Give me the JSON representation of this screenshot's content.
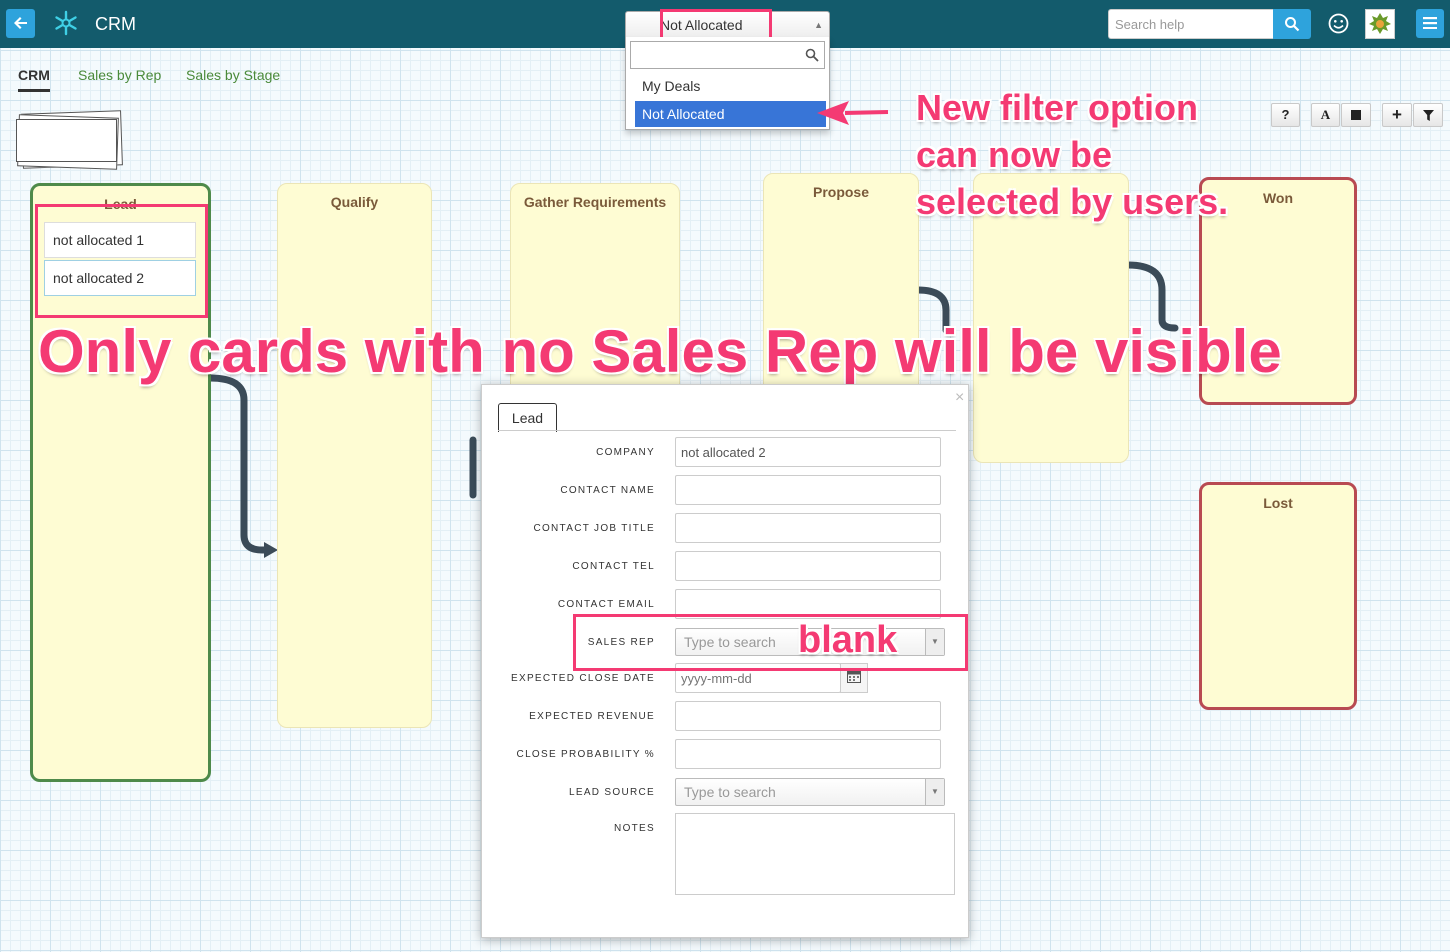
{
  "app": {
    "title": "CRM"
  },
  "header": {
    "filter_value": "Not Allocated",
    "filter_options": [
      "My Deals",
      "Not Allocated"
    ],
    "search_placeholder": "Search help"
  },
  "tabs": [
    "CRM",
    "Sales by Rep",
    "Sales by Stage"
  ],
  "toolbar": {
    "help": "?",
    "font": "A",
    "add": "+"
  },
  "board": {
    "columns": [
      {
        "title": "Lead",
        "cards": [
          "not allocated 1",
          "not allocated 2"
        ]
      },
      {
        "title": "Qualify"
      },
      {
        "title": "Gather Requirements"
      },
      {
        "title": "Propose"
      },
      {
        "title": "Won"
      },
      {
        "title": "Lost"
      }
    ]
  },
  "modal": {
    "tab": "Lead",
    "close": "×",
    "fields": [
      {
        "label": "COMPANY",
        "value": "not allocated 2"
      },
      {
        "label": "CONTACT NAME",
        "value": ""
      },
      {
        "label": "CONTACT JOB TITLE",
        "value": ""
      },
      {
        "label": "CONTACT TEL",
        "value": ""
      },
      {
        "label": "CONTACT EMAIL",
        "value": ""
      },
      {
        "label": "SALES REP",
        "placeholder": "Type to search"
      },
      {
        "label": "EXPECTED CLOSE DATE",
        "placeholder": "yyyy-mm-dd"
      },
      {
        "label": "EXPECTED REVENUE",
        "value": ""
      },
      {
        "label": "CLOSE PROBABILITY %",
        "value": ""
      },
      {
        "label": "LEAD SOURCE",
        "placeholder": "Type to search"
      },
      {
        "label": "NOTES",
        "value": ""
      }
    ]
  },
  "annotations": {
    "filter_note": [
      "New filter option",
      "can now be",
      "selected by users."
    ],
    "main_note": "Only cards with no Sales Rep will be visible",
    "blank_note": "blank"
  },
  "colors": {
    "topbar": "#135b6c",
    "accent": "#2ea3dc",
    "annotation": "#f43a73",
    "selected": "#3875d7"
  }
}
